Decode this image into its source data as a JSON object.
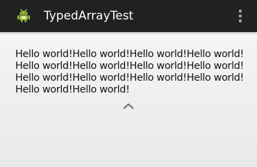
{
  "app": {
    "title": "TypedArrayTest",
    "icon": "android-robot-icon",
    "menu_icon": "overflow-menu-icon"
  },
  "content": {
    "text": "Hello world!Hello world!Hello world!Hello world!\nHello world!Hello world!Hello world!Hello world!\nHello world!Hello world!Hello world!Hello world!\nHello world!Hello world!",
    "chevron_icon": "chevron-up-icon"
  },
  "colors": {
    "action_bar": "#212121",
    "title_text": "#ffffff",
    "body_text": "#111111",
    "android_green": "#9fbf3b"
  }
}
